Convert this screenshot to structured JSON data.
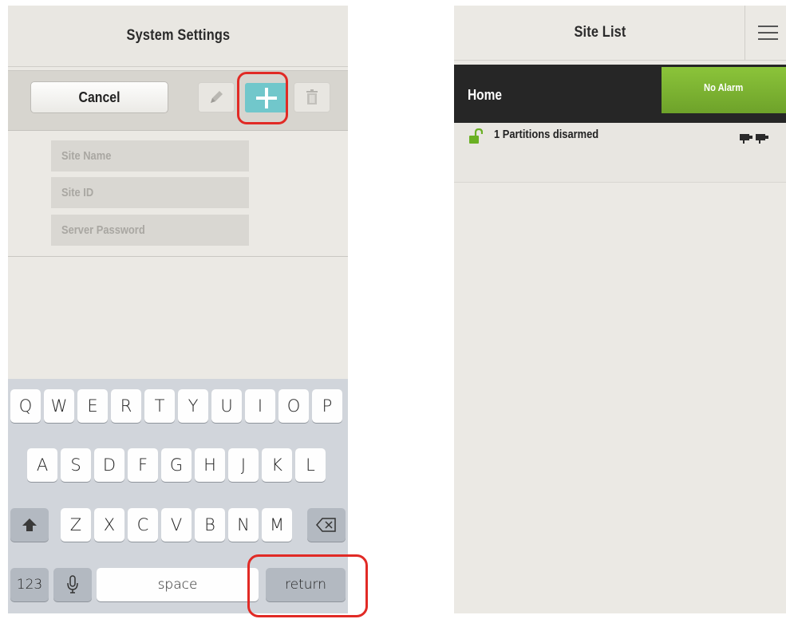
{
  "left_screen": {
    "title": "System Settings",
    "toolbar": {
      "cancel_label": "Cancel",
      "edit_icon": "pencil-icon",
      "add_icon": "plus-icon",
      "delete_icon": "trash-icon",
      "add_color": "#71c7cb"
    },
    "form": {
      "site_name_placeholder": "Site Name",
      "site_id_placeholder": "Site ID",
      "server_password_placeholder": "Server Password"
    },
    "keyboard": {
      "row1": [
        "Q",
        "W",
        "E",
        "R",
        "T",
        "Y",
        "U",
        "I",
        "O",
        "P"
      ],
      "row2": [
        "A",
        "S",
        "D",
        "F",
        "G",
        "H",
        "J",
        "K",
        "L"
      ],
      "row3": [
        "Z",
        "X",
        "C",
        "V",
        "B",
        "N",
        "M"
      ],
      "shift_icon": "shift-arrow-icon",
      "backspace_icon": "backspace-icon",
      "numbers_label": "123",
      "mic_icon": "microphone-icon",
      "space_label": "space",
      "return_label": "return"
    }
  },
  "right_screen": {
    "title": "Site List",
    "menu_icon": "hamburger-menu-icon",
    "site": {
      "name": "Home",
      "status": "No Alarm",
      "status_color": "#7fb832"
    },
    "partition": {
      "text": "1 Partitions disarmed",
      "lock_icon": "unlocked-padlock-icon",
      "camera_icon": "camera-icon"
    }
  },
  "annotation_color": "#e12a25"
}
